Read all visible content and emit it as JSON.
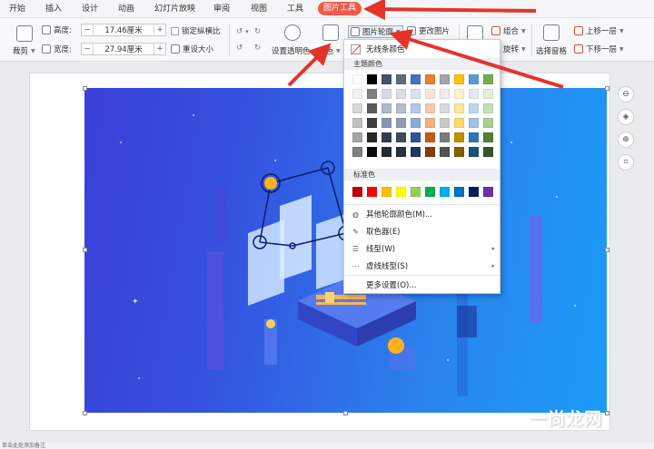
{
  "tabs": [
    "开始",
    "插入",
    "设计",
    "动画",
    "幻灯片放映",
    "审阅",
    "视图",
    "工具",
    "图片工具"
  ],
  "ribbon": {
    "crop": "裁剪",
    "height_label": "高度:",
    "height_value": "17.46厘米",
    "width_label": "宽度:",
    "width_value": "27.94厘米",
    "lock_ratio": "锁定纵横比",
    "reset_size": "重设大小",
    "set_transparent": "设置透明色",
    "color": "颜色",
    "outline": "图片轮廓",
    "change_picture": "更改图片",
    "group": "组合",
    "rotate": "旋转",
    "selection_pane": "选择窗格",
    "bring_forward": "上移一层",
    "send_backward": "下移一层"
  },
  "dropdown": {
    "no_line": "无线条颜色",
    "theme_colors": "主题颜色",
    "theme_rows": [
      [
        "#ffffff",
        "#000000",
        "#44546a",
        "#5a6b7d",
        "#4472c4",
        "#ed7d31",
        "#a5a5a5",
        "#ffc000",
        "#5b9bd5",
        "#70ad47"
      ],
      [
        "#f2f2f2",
        "#7f7f7f",
        "#d6dce4",
        "#d9dde4",
        "#d9e2f3",
        "#fbe4d5",
        "#ededed",
        "#fff2cc",
        "#deebf6",
        "#e2efd9"
      ],
      [
        "#d8d8d8",
        "#595959",
        "#adb9ca",
        "#b4bdca",
        "#b4c6e7",
        "#f7caac",
        "#dbdbdb",
        "#fee599",
        "#bdd7ee",
        "#c5e0b3"
      ],
      [
        "#bfbfbf",
        "#3f3f3f",
        "#8496b0",
        "#8f9bb0",
        "#8eaadb",
        "#f4b183",
        "#c9c9c9",
        "#ffd965",
        "#9cc3e5",
        "#a8d08d"
      ],
      [
        "#a5a5a5",
        "#262626",
        "#333f4f",
        "#3d4a5a",
        "#2f5496",
        "#c45911",
        "#7b7b7b",
        "#bf8f00",
        "#2e75b5",
        "#538135"
      ],
      [
        "#7f7f7f",
        "#0c0c0c",
        "#222a35",
        "#28303b",
        "#1f3864",
        "#833c0b",
        "#525252",
        "#7f6000",
        "#1e4e79",
        "#375623"
      ]
    ],
    "standard_colors": "标准色",
    "standard_row": [
      "#c00000",
      "#ff0000",
      "#ffc000",
      "#ffff00",
      "#92d050",
      "#00b050",
      "#00b0f0",
      "#0070c0",
      "#002060",
      "#7030a0"
    ],
    "more_colors": "其他轮廓颜色(M)...",
    "eyedropper": "取色器(E)",
    "line_type": "线型(W)",
    "dash_type": "虚线线型(S)",
    "more_settings": "更多设置(O)..."
  },
  "status": "单击此处添加备注",
  "watermark": "一尚龙网",
  "colors": {
    "accent": "#f05a4b",
    "arrow": "#e5332a"
  }
}
